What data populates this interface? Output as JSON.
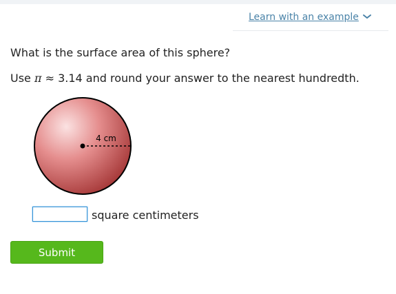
{
  "header": {
    "learn_link": "Learn with an example",
    "chevron_icon": "chevron-down-icon"
  },
  "question": {
    "text": "What is the surface area of this sphere?",
    "instruction_prefix": "Use ",
    "pi_symbol": "π",
    "instruction_suffix": " ≈ 3.14 and round your answer to the nearest hundredth."
  },
  "figure": {
    "radius_label": "4 cm",
    "colors": {
      "sphere_light": "#fbe2e2",
      "sphere_mid": "#e58e8e",
      "sphere_dark": "#a83b3b",
      "outline": "#000000"
    }
  },
  "answer": {
    "value": "",
    "placeholder": "",
    "unit": "square centimeters"
  },
  "submit": {
    "label": "Submit",
    "color": "#56b81c"
  }
}
